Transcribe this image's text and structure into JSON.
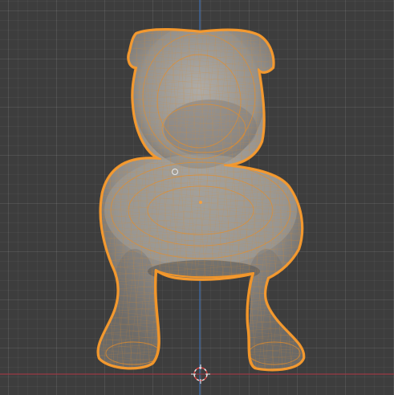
{
  "viewport": {
    "background_color": "#3d3d3d",
    "grid_color": "#4a4a4a",
    "z_axis_color": "#3f6fb0",
    "x_axis_color": "#9a3a44",
    "selection_outline_color": "#f0952a",
    "mesh_base_color": "#8c8a86",
    "wire_color": "#e58e2a"
  },
  "scene": {
    "object": "bulldog-mesh",
    "mode": "edit-wireframe-overlay",
    "selected": true
  },
  "icons": {
    "cursor": "3d-cursor-icon",
    "origin": "object-origin-icon",
    "light": "light-icon"
  }
}
